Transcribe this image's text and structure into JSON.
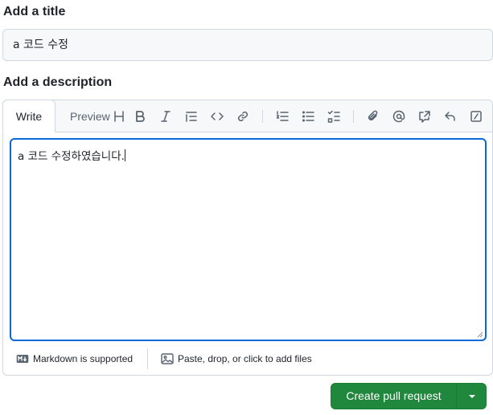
{
  "title_section": {
    "label": "Add a title",
    "value": "a 코드 수정"
  },
  "description_section": {
    "label": "Add a description",
    "tabs": {
      "write": "Write",
      "preview": "Preview"
    },
    "toolbar_icons": [
      "heading-icon",
      "bold-icon",
      "italic-icon",
      "quote-icon",
      "code-icon",
      "link-icon",
      "ordered-list-icon",
      "unordered-list-icon",
      "task-list-icon",
      "attach-icon",
      "mention-icon",
      "reference-icon",
      "reply-icon",
      "slash-command-icon"
    ],
    "body": "a 코드 수정하였습니다.",
    "footer": {
      "markdown": "Markdown is supported",
      "attach": "Paste, drop, or click to add files"
    }
  },
  "actions": {
    "create_pr": "Create pull request"
  },
  "colors": {
    "primary_green": "#1f883d",
    "focus_blue": "#0969da",
    "border": "#d0d7de"
  }
}
